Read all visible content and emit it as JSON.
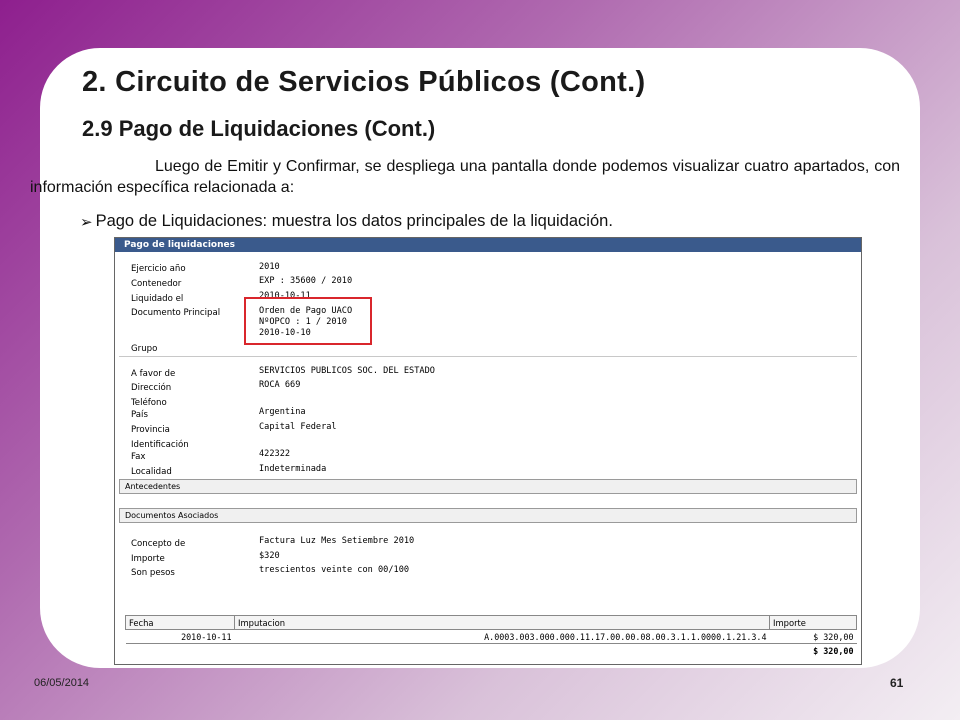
{
  "slide": {
    "title": "2. Circuito de Servicios Públicos (Cont.)",
    "subtitle": "2.9 Pago de Liquidaciones (Cont.)",
    "body": "Luego de Emitir y Confirmar, se despliega una pantalla donde podemos visualizar cuatro apartados, con información específica relacionada a:",
    "bullet": "Pago de Liquidaciones: muestra los datos principales de la liquidación.",
    "footer_date": "06/05/2014",
    "page_number": "61"
  },
  "screen": {
    "header": "Pago de liquidaciones",
    "group1": [
      {
        "label": "Ejercicio año",
        "value": "2010"
      },
      {
        "label": "Contenedor",
        "value": "EXP : 35600 / 2010"
      },
      {
        "label": "Liquidado el",
        "value": "2010-10-11"
      },
      {
        "label": "Documento Principal",
        "value": "Orden de Pago UACO",
        "value2": "NºOPCO : 1 / 2010",
        "value3": "2010-10-10"
      },
      {
        "label": "Grupo",
        "value": ""
      }
    ],
    "group2": [
      {
        "label": "A favor de",
        "value": "SERVICIOS PUBLICOS SOC. DEL ESTADO"
      },
      {
        "label": "Dirección",
        "value": "ROCA 669"
      },
      {
        "label": "Teléfono",
        "value": ""
      },
      {
        "label": "País",
        "value": "Argentina"
      },
      {
        "label": "Provincia",
        "value": "Capital Federal"
      },
      {
        "label": "Identificación",
        "value": ""
      },
      {
        "label": "Fax",
        "value": "422322"
      },
      {
        "label": "Localidad",
        "value": "Indeterminada"
      }
    ],
    "antecedentes_label": "Antecedentes",
    "documentos_label": "Documentos Asociados",
    "group3": [
      {
        "label": "Concepto de",
        "value": "Factura Luz Mes Setiembre 2010"
      },
      {
        "label": "Importe",
        "value": "$320"
      },
      {
        "label": "Son pesos",
        "value": "trescientos veinte con 00/100"
      }
    ],
    "table": {
      "headers": [
        "Fecha",
        "Imputacion",
        "Importe"
      ],
      "row": {
        "fecha": "2010-10-11",
        "imputacion": "A.0003.003.000.000.11.17.00.00.08.00.3.1.1.0000.1.21.3.4",
        "importe": "$ 320,00"
      },
      "total": "$ 320,00"
    }
  },
  "colors": {
    "highlight": "#d9262c",
    "screen_header": "#3a5a8c"
  }
}
